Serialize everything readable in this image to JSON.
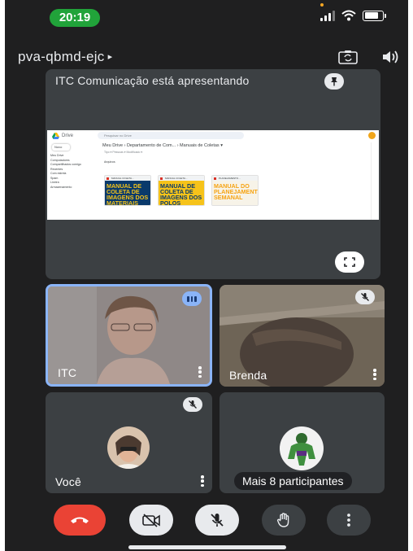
{
  "status_bar": {
    "time": "20:19",
    "battery_level": 0.8
  },
  "meeting": {
    "code": "pva-qbmd-ejc",
    "code_caret": "▸"
  },
  "presentation": {
    "title": "ITC Comunicação está apresentando",
    "screen": {
      "app_name": "Drive",
      "search_placeholder": "Pesquisar no Drive",
      "new_button": "Novo",
      "sidebar_items": [
        "Meu Drive",
        "Computadores",
        "Compartilhados comigo",
        "Recentes",
        "Com estrela",
        "Spam",
        "Lixeira",
        "Armazenamento"
      ],
      "breadcrumb": "Meu Drive  ›  Departamento de Com...  ›  Manuais de Coletas  ▾",
      "filter_text": "Tipo  ▾   Pessoas  ▾   Modificado  ▾",
      "section_label": "Arquivos",
      "cards": [
        {
          "header": "MANUAL COLETA...",
          "title": "MANUAL DE COLETA DE IMAGENS DOS MATERIAIS"
        },
        {
          "header": "MANUAL COLETA...",
          "title": "MANUAL DE COLETA DE IMAGENS DOS POLOS"
        },
        {
          "header": "PLANEJAMENTO...",
          "title": "MANUAL DO PLANEJAMENT SEMANAL"
        }
      ]
    }
  },
  "participants": [
    {
      "name": "ITC",
      "speaking": true,
      "muted": false
    },
    {
      "name": "Brenda",
      "speaking": false,
      "muted": true
    },
    {
      "name": "Você",
      "speaking": false,
      "muted": true
    },
    {
      "name": "Mais 8 participantes",
      "speaking": false,
      "muted": false
    }
  ],
  "icons": {
    "camera_flip": "camera-flip-icon",
    "speaker": "speaker-icon",
    "pin": "pin-icon",
    "fullscreen": "fullscreen-icon",
    "end_call": "end-call-icon",
    "camera_off": "camera-off-icon",
    "mic_off": "mic-off-icon",
    "raise_hand": "raise-hand-icon",
    "more": "more-options-icon"
  },
  "colors": {
    "background": "#1f1f20",
    "tile": "#3c4043",
    "time_pill": "#21a33a",
    "active_speaker": "#8ab4f8",
    "end_call": "#ea4335",
    "control_light": "#e8eaed"
  }
}
